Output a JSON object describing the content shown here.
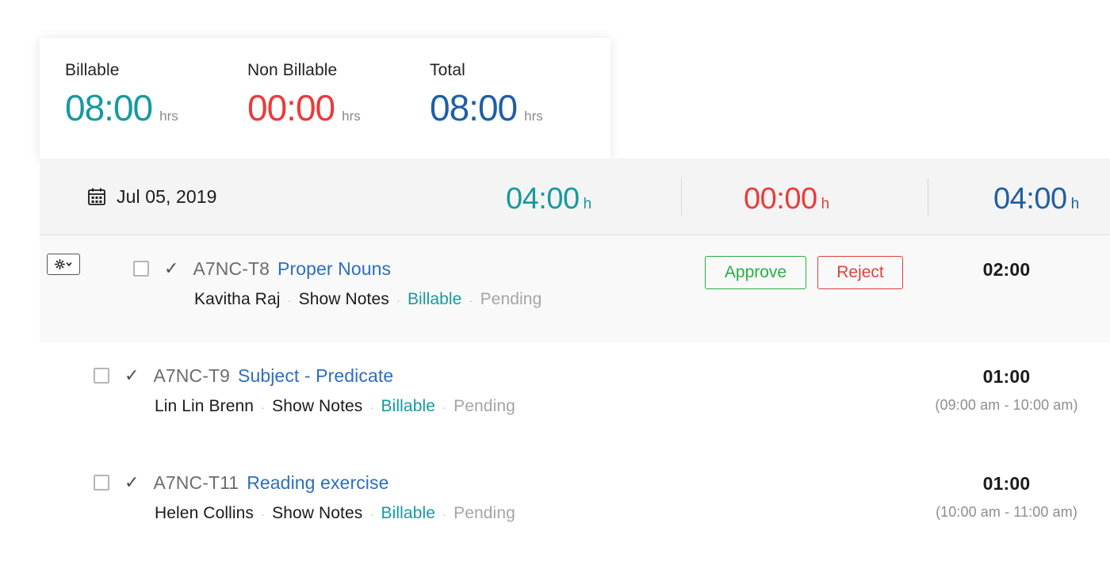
{
  "summary": {
    "blocks": [
      {
        "label": "Billable",
        "value": "08:00",
        "unit": "hrs",
        "color": "#169a9e"
      },
      {
        "label": "Non Billable",
        "value": "00:00",
        "unit": "hrs",
        "color": "#ea3b3b"
      },
      {
        "label": "Total",
        "value": "08:00",
        "unit": "hrs",
        "color": "#1f5fa4"
      }
    ]
  },
  "date_bar": {
    "icon": "calendar-icon",
    "date": "Jul 05, 2019",
    "billable": {
      "value": "04:00",
      "unit": "h",
      "color": "#169a9e"
    },
    "non_billable": {
      "value": "00:00",
      "unit": "h",
      "color": "#ea3b3b"
    },
    "total": {
      "value": "04:00",
      "unit": "h",
      "color": "#1f5fa4"
    }
  },
  "gear_menu": {
    "icon": "gear-icon",
    "caret": "chevron-down-icon"
  },
  "separator": "·",
  "rows": [
    {
      "task_id": "A7NC-T8",
      "task_name": "Proper Nouns",
      "user": "Kavitha Raj",
      "notes": "Show Notes",
      "billable": "Billable",
      "status": "Pending",
      "duration": "02:00",
      "time_range": "",
      "approve_label": "Approve",
      "reject_label": "Reject",
      "has_actions": true,
      "highlight": true
    },
    {
      "task_id": "A7NC-T9",
      "task_name": "Subject - Predicate",
      "user": "Lin Lin Brenn",
      "notes": "Show Notes",
      "billable": "Billable",
      "status": "Pending",
      "duration": "01:00",
      "time_range": "(09:00 am - 10:00 am)",
      "approve_label": "Approve",
      "reject_label": "Reject",
      "has_actions": false,
      "highlight": false
    },
    {
      "task_id": "A7NC-T11",
      "task_name": "Reading exercise",
      "user": "Helen Collins",
      "notes": "Show Notes",
      "billable": "Billable",
      "status": "Pending",
      "duration": "01:00",
      "time_range": "(10:00 am - 11:00 am)",
      "approve_label": "Approve",
      "reject_label": "Reject",
      "has_actions": false,
      "highlight": false
    }
  ]
}
